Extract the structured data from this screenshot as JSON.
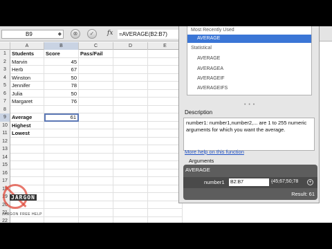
{
  "formula_bar": {
    "name_box": "B9",
    "cancel_glyph": "⊗",
    "confirm_glyph": "✓",
    "fx_label": "fx",
    "formula": "=AVERAGE(B2:B7)"
  },
  "grid": {
    "columns": [
      "A",
      "B",
      "C",
      "D",
      "E"
    ],
    "rows": [
      {
        "num": "1",
        "a": "Students",
        "b": "Score",
        "c": "Pass/Fail"
      },
      {
        "num": "2",
        "a": "Marvin",
        "b": "45",
        "c": ""
      },
      {
        "num": "3",
        "a": "Herb",
        "b": "67",
        "c": ""
      },
      {
        "num": "4",
        "a": "Winston",
        "b": "50",
        "c": ""
      },
      {
        "num": "5",
        "a": "Jennifer",
        "b": "78",
        "c": ""
      },
      {
        "num": "6",
        "a": "Julia",
        "b": "50",
        "c": ""
      },
      {
        "num": "7",
        "a": "Margaret",
        "b": "76",
        "c": ""
      },
      {
        "num": "8",
        "a": "",
        "b": "",
        "c": ""
      },
      {
        "num": "9",
        "a": "Average",
        "b": "61",
        "c": ""
      },
      {
        "num": "10",
        "a": "Highest",
        "b": "",
        "c": ""
      },
      {
        "num": "11",
        "a": "Lowest",
        "b": "",
        "c": ""
      },
      {
        "num": "12",
        "a": "",
        "b": "",
        "c": ""
      },
      {
        "num": "13",
        "a": "",
        "b": "",
        "c": ""
      },
      {
        "num": "14",
        "a": "",
        "b": "",
        "c": ""
      },
      {
        "num": "15",
        "a": "",
        "b": "",
        "c": ""
      },
      {
        "num": "16",
        "a": "",
        "b": "",
        "c": ""
      },
      {
        "num": "17",
        "a": "",
        "b": "",
        "c": ""
      },
      {
        "num": "18",
        "a": "",
        "b": "",
        "c": ""
      },
      {
        "num": "19",
        "a": "",
        "b": "",
        "c": ""
      },
      {
        "num": "20",
        "a": "",
        "b": "",
        "c": ""
      },
      {
        "num": "21",
        "a": "",
        "b": "",
        "c": ""
      },
      {
        "num": "22",
        "a": "",
        "b": "",
        "c": ""
      }
    ]
  },
  "watermark": {
    "logo_text": "JARGON",
    "tagline": "JARGON FREE HELP"
  },
  "formula_builder": {
    "list": {
      "most_recent_header": "Most Recently Used",
      "selected_item": "AVERAGE",
      "statistical_header": "Statistical",
      "items": [
        "AVERAGE",
        "AVERAGEA",
        "AVERAGEIF",
        "AVERAGEIFS"
      ]
    },
    "grip": "• • •",
    "description_label": "Description",
    "description_text": "number1: number1,number2,... are 1 to 255 numeric arguments for which you want the average.",
    "help_link": "More help on this function",
    "arguments_label": "Arguments",
    "function_name": "AVERAGE",
    "argument_name": "number1",
    "argument_input": "B2:B7",
    "argument_value": "{45;67;50;78",
    "result_label": "Result: 61"
  }
}
